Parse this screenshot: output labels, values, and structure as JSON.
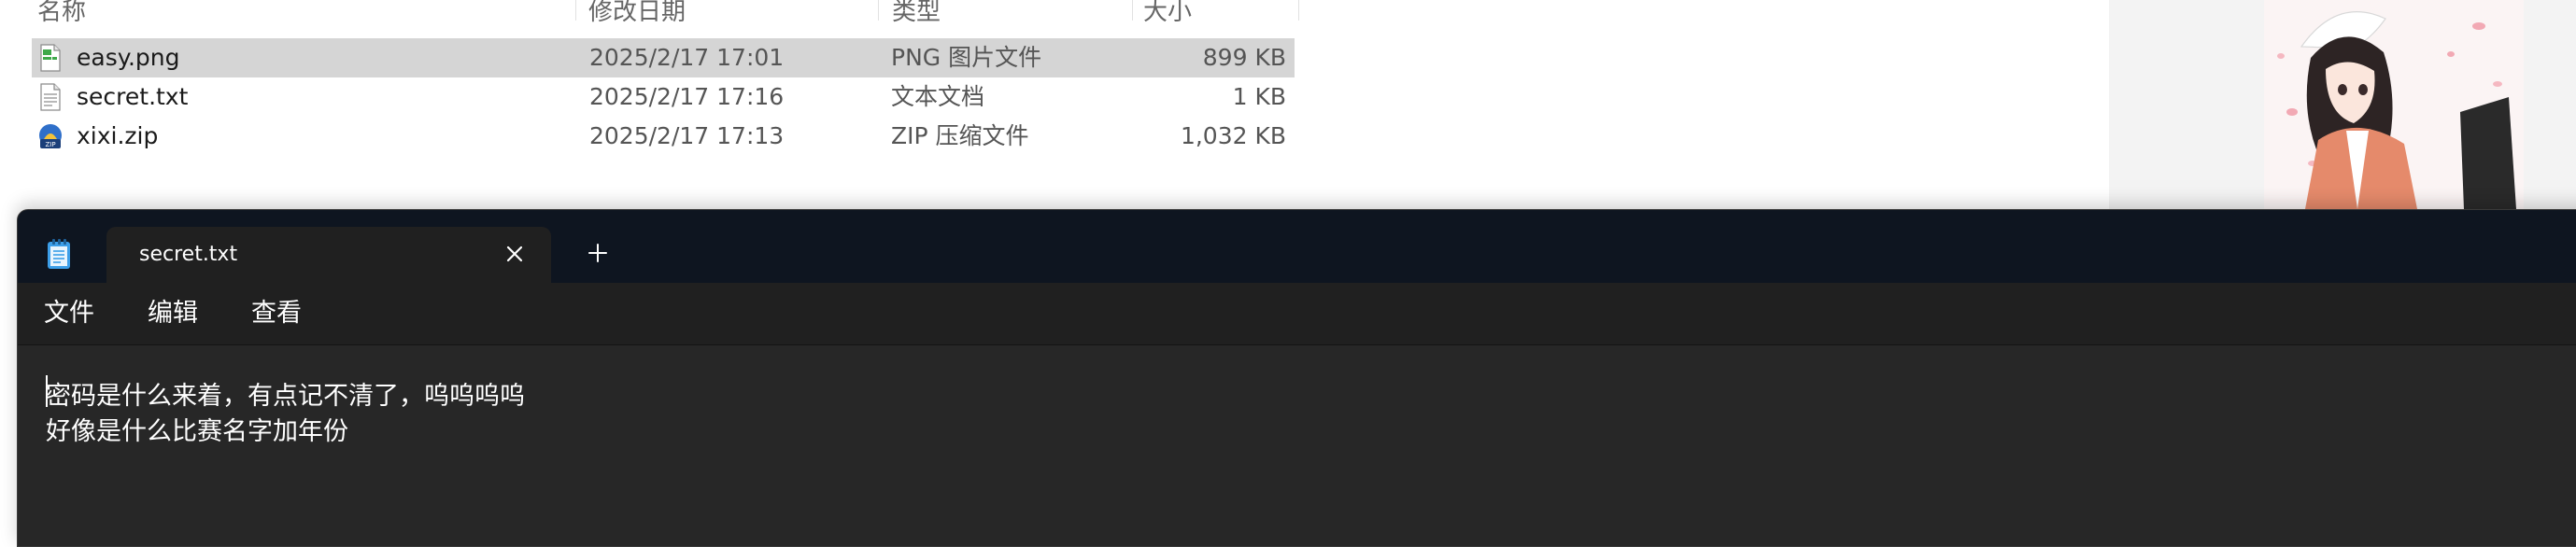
{
  "explorer": {
    "columns": {
      "name": "名称",
      "modified": "修改日期",
      "type": "类型",
      "size": "大小"
    },
    "files": [
      {
        "name": "easy.png",
        "modified": "2025/2/17 17:01",
        "type": "PNG 图片文件",
        "size": "899 KB",
        "icon": "png-file-icon",
        "selected": true
      },
      {
        "name": "secret.txt",
        "modified": "2025/2/17 17:16",
        "type": "文本文档",
        "size": "1 KB",
        "icon": "text-file-icon",
        "selected": false
      },
      {
        "name": "xixi.zip",
        "modified": "2025/2/17 17:13",
        "type": "ZIP 压缩文件",
        "size": "1,032 KB",
        "icon": "zip-file-icon",
        "selected": false
      }
    ],
    "zip_icon_label": "ZIP"
  },
  "notepad": {
    "tab_title": "secret.txt",
    "menu": [
      "文件",
      "编辑",
      "查看"
    ],
    "content_lines": [
      "密码是什么来着，有点记不清了，呜呜呜呜",
      "好像是什么比赛名字加年份"
    ],
    "colors": {
      "titlebar": "#0e1520",
      "tab": "#202020",
      "editor": "#272727",
      "text": "#ffffff"
    }
  }
}
